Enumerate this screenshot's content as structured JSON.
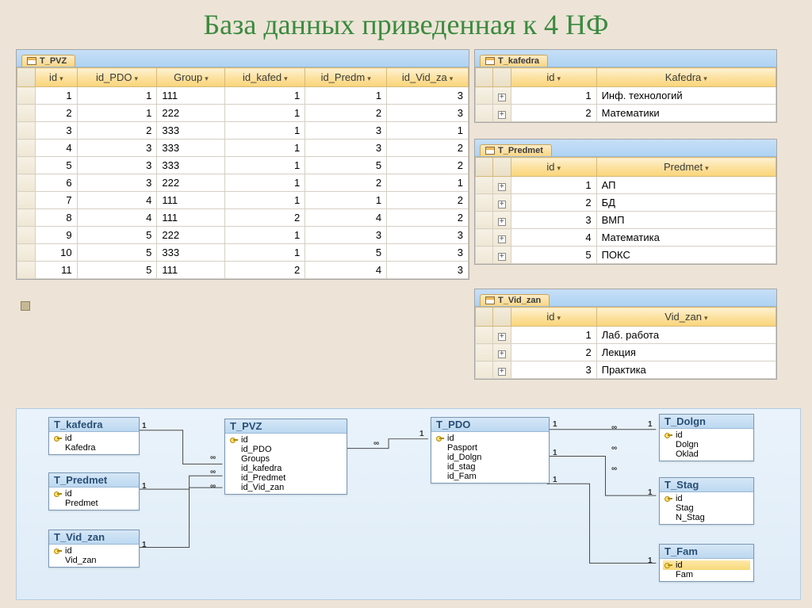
{
  "title": "База данных приведенная к 4 НФ",
  "tables": {
    "t_pvz": {
      "tab": "T_PVZ",
      "cols": [
        "id",
        "id_PDO",
        "Group",
        "id_kafed",
        "id_Predm",
        "id_Vid_za"
      ],
      "rows": [
        [
          1,
          1,
          "111",
          1,
          1,
          3
        ],
        [
          2,
          1,
          "222",
          1,
          2,
          3
        ],
        [
          3,
          2,
          "333",
          1,
          3,
          1
        ],
        [
          4,
          3,
          "333",
          1,
          3,
          2
        ],
        [
          5,
          3,
          "333",
          1,
          5,
          2
        ],
        [
          6,
          3,
          "222",
          1,
          2,
          1
        ],
        [
          7,
          4,
          "111",
          1,
          1,
          2
        ],
        [
          8,
          4,
          "111",
          2,
          4,
          2
        ],
        [
          9,
          5,
          "222",
          1,
          3,
          3
        ],
        [
          10,
          5,
          "333",
          1,
          5,
          3
        ],
        [
          11,
          5,
          "111",
          2,
          4,
          3
        ]
      ]
    },
    "t_kafedra": {
      "tab": "T_kafedra",
      "cols": [
        "id",
        "Kafedra"
      ],
      "rows": [
        [
          1,
          "Инф. технологий"
        ],
        [
          2,
          "Математики"
        ]
      ]
    },
    "t_predmet": {
      "tab": "T_Predmet",
      "cols": [
        "id",
        "Predmet"
      ],
      "rows": [
        [
          1,
          "АП"
        ],
        [
          2,
          "БД"
        ],
        [
          3,
          "ВМП"
        ],
        [
          4,
          "Математика"
        ],
        [
          5,
          "ПОКС"
        ]
      ]
    },
    "t_vid_zan": {
      "tab": "T_Vid_zan",
      "cols": [
        "id",
        "Vid_zan"
      ],
      "rows": [
        [
          1,
          "Лаб. работа"
        ],
        [
          2,
          "Лекция"
        ],
        [
          3,
          "Практика"
        ]
      ]
    }
  },
  "rel": {
    "boxes": [
      {
        "name": "T_kafedra",
        "fields": [
          "id",
          "Kafedra"
        ],
        "hl": null
      },
      {
        "name": "T_Predmet",
        "fields": [
          "id",
          "Predmet"
        ],
        "hl": null
      },
      {
        "name": "T_Vid_zan",
        "fields": [
          "id",
          "Vid_zan"
        ],
        "hl": null
      },
      {
        "name": "T_PVZ",
        "fields": [
          "id",
          "id_PDO",
          "Groups",
          "id_kafedra",
          "id_Predmet",
          "id_Vid_zan"
        ],
        "hl": null
      },
      {
        "name": "T_PDO",
        "fields": [
          "id",
          "Pasport",
          "id_Dolgn",
          "id_stag",
          "id_Fam"
        ],
        "hl": null
      },
      {
        "name": "T_Dolgn",
        "fields": [
          "id",
          "Dolgn",
          "Oklad"
        ],
        "hl": null
      },
      {
        "name": "T_Stag",
        "fields": [
          "id",
          "Stag",
          "N_Stag"
        ],
        "hl": null
      },
      {
        "name": "T_Fam",
        "fields": [
          "id",
          "Fam"
        ],
        "hl": 0
      }
    ],
    "one": "1",
    "many": "∞"
  }
}
